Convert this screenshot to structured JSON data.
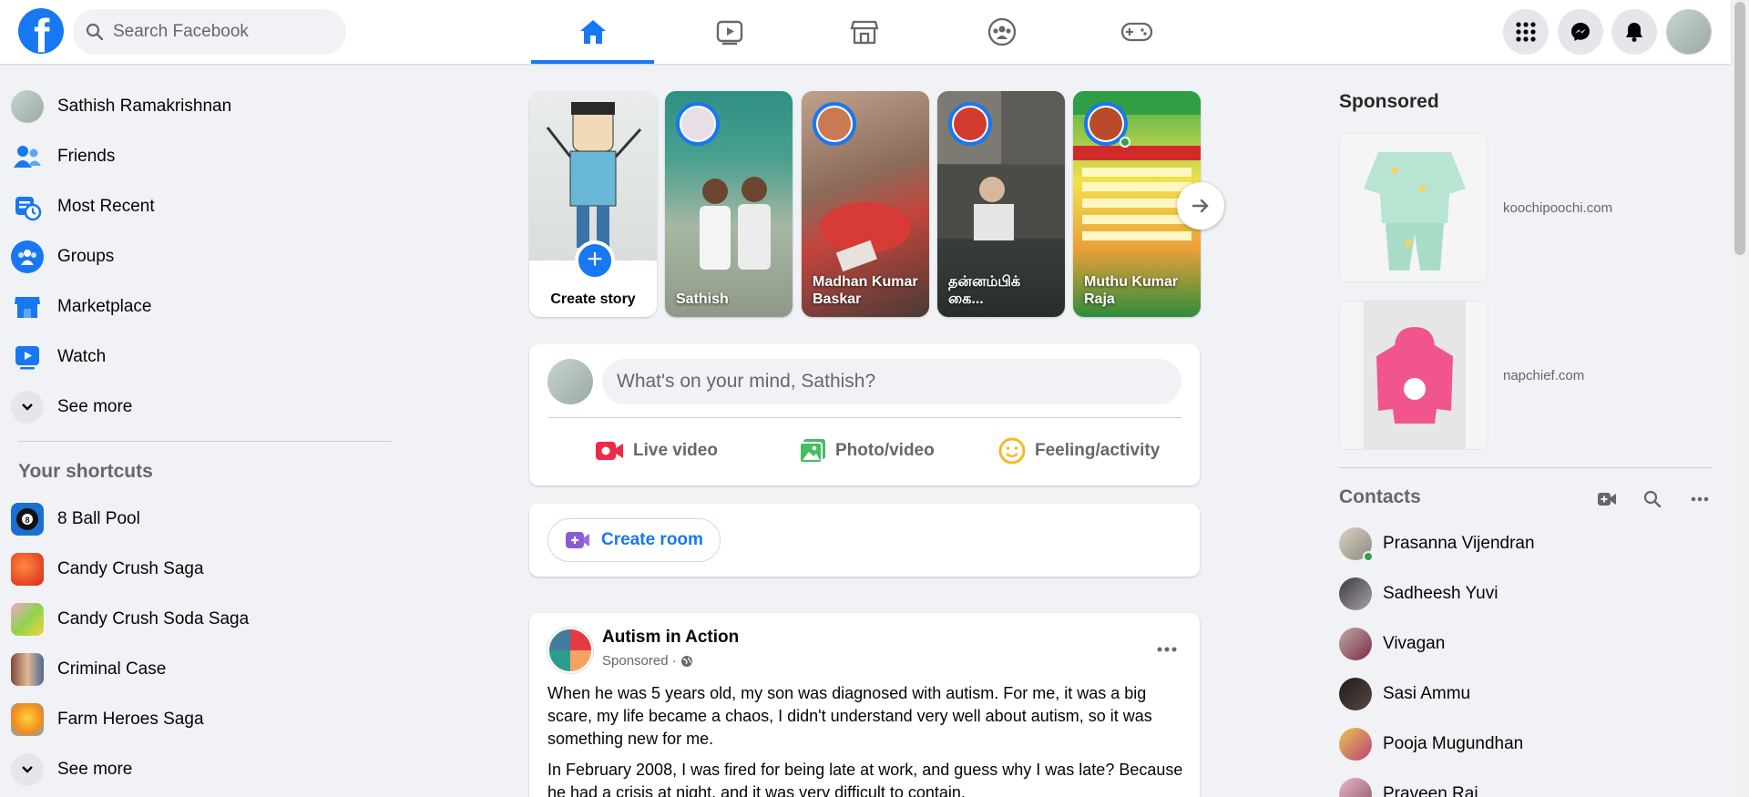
{
  "header": {
    "logo": "f",
    "search_placeholder": "Search Facebook",
    "nav_tabs": [
      {
        "icon": "home-icon",
        "active": true
      },
      {
        "icon": "watch-icon",
        "active": false
      },
      {
        "icon": "marketplace-icon",
        "active": false
      },
      {
        "icon": "groups-icon",
        "active": false
      },
      {
        "icon": "gaming-icon",
        "active": false
      }
    ],
    "right_buttons": [
      "menu-grid-icon",
      "messenger-icon",
      "notifications-icon",
      "account-avatar"
    ]
  },
  "sidebar": {
    "items": [
      {
        "label": "Sathish Ramakrishnan",
        "icon": "profile-avatar"
      },
      {
        "label": "Friends",
        "icon": "friends-icon"
      },
      {
        "label": "Most Recent",
        "icon": "most-recent-icon"
      },
      {
        "label": "Groups",
        "icon": "groups-icon"
      },
      {
        "label": "Marketplace",
        "icon": "marketplace-icon"
      },
      {
        "label": "Watch",
        "icon": "watch-icon"
      },
      {
        "label": "See more",
        "icon": "chevron-down-icon"
      }
    ],
    "shortcuts_title": "Your shortcuts",
    "shortcuts": [
      {
        "label": "8 Ball Pool"
      },
      {
        "label": "Candy Crush Saga"
      },
      {
        "label": "Candy Crush Soda Saga"
      },
      {
        "label": "Criminal Case"
      },
      {
        "label": "Farm Heroes Saga"
      },
      {
        "label": "See more"
      }
    ]
  },
  "stories": {
    "create_label": "Create story",
    "items": [
      {
        "name": "Sathish"
      },
      {
        "name": "Madhan Kumar Baskar"
      },
      {
        "name": "தன்னம்பிக் கை..."
      },
      {
        "name": "Muthu Kumar Raja"
      }
    ]
  },
  "composer": {
    "placeholder": "What's on your mind, Sathish?",
    "actions": [
      "Live video",
      "Photo/video",
      "Feeling/activity"
    ]
  },
  "room": {
    "label": "Create room"
  },
  "post": {
    "author": "Autism in Action",
    "meta": "Sponsored ·",
    "paragraphs": [
      "When he was 5 years old, my son was diagnosed with autism. For me, it was a big scare, my life became a chaos, I didn't understand very well about autism, so it was something new for me.",
      "In February 2008, I was fired for being late at work, and guess why I was late? Because he had a crisis at night, and it was very difficult to contain."
    ]
  },
  "right": {
    "sponsored_title": "Sponsored",
    "ads": [
      {
        "site": "koochipoochi.com"
      },
      {
        "site": "napchief.com"
      }
    ],
    "contacts_title": "Contacts",
    "contacts": [
      {
        "name": "Prasanna Vijendran",
        "online": true
      },
      {
        "name": "Sadheesh Yuvi",
        "online": false
      },
      {
        "name": "Vivagan",
        "online": false
      },
      {
        "name": "Sasi Ammu",
        "online": false
      },
      {
        "name": "Pooja Mugundhan",
        "online": false
      },
      {
        "name": "Praveen Raj",
        "online": false
      }
    ]
  },
  "colors": {
    "brand": "#1877f2",
    "background": "#f0f2f5",
    "secondary_text": "#65676b",
    "online": "#31a24c"
  }
}
